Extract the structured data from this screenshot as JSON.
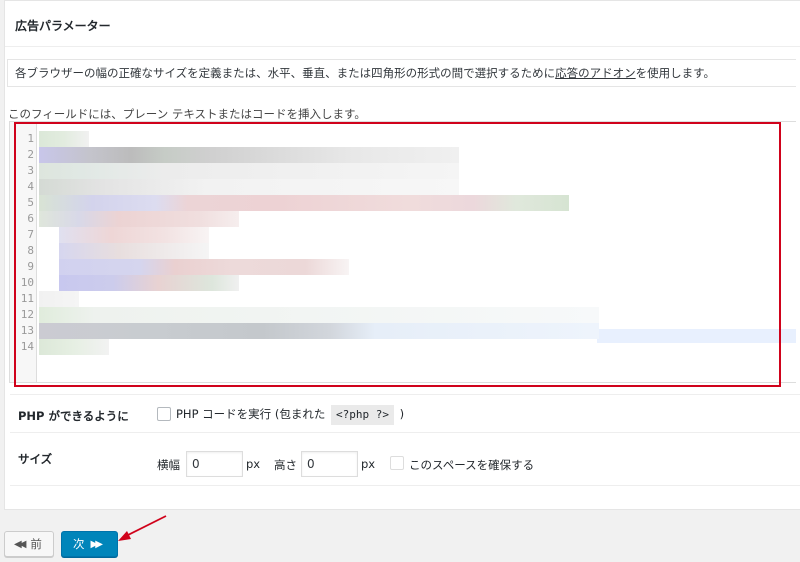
{
  "panel": {
    "title": "広告パラメーター",
    "description_prefix": "各ブラウザーの幅の正確なサイズを定義または、水平、垂直、または四角形の形式の間で選択するために",
    "description_link": "応答のアドオン",
    "description_suffix": "を使用します。",
    "hint": "このフィールドには、プレーン テキストまたはコードを挿入します。"
  },
  "editor": {
    "line_numbers": [
      "1",
      "2",
      "3",
      "4",
      "5",
      "6",
      "7",
      "8",
      "9",
      "10",
      "11",
      "12",
      "13",
      "14"
    ],
    "content_note": "blurred"
  },
  "php_row": {
    "label": "PHP ができるように",
    "checkbox_text": "PHP コードを実行 (包まれた",
    "code_tag": "<?php ?>",
    "close_paren": ")",
    "checked": false
  },
  "size_row": {
    "label": "サイズ",
    "width_label": "横幅",
    "width_value": "0",
    "width_unit": "px",
    "height_label": "高さ",
    "height_value": "0",
    "height_unit": "px",
    "reserve_label": "このスペースを確保する",
    "reserve_checked": false
  },
  "nav": {
    "prev_label": "前",
    "prev_icon": "double-left-arrow-icon",
    "next_label": "次",
    "next_icon": "double-right-arrow-icon"
  },
  "colors": {
    "accent": "#0085ba",
    "annotation": "#d0021b"
  }
}
